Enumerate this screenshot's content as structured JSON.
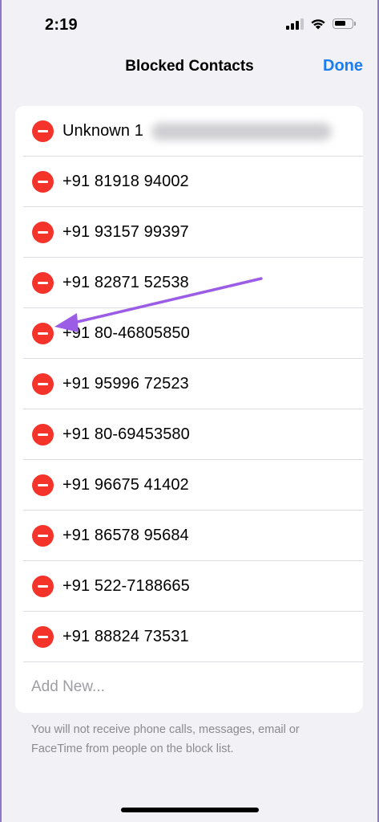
{
  "status_bar": {
    "time": "2:19",
    "icons": [
      "cellular-signal-icon",
      "wifi-icon",
      "battery-icon"
    ]
  },
  "nav": {
    "title": "Blocked Contacts",
    "done_label": "Done"
  },
  "contacts": [
    {
      "label": "Unknown 1",
      "has_blurred_detail": true
    },
    {
      "label": "+91 81918 94002"
    },
    {
      "label": "+91 93157 99397"
    },
    {
      "label": "+91 82871 52538"
    },
    {
      "label": "+91 80-46805850"
    },
    {
      "label": "+91 95996 72523"
    },
    {
      "label": "+91 80-69453580"
    },
    {
      "label": "+91 96675 41402"
    },
    {
      "label": "+91 86578 95684"
    },
    {
      "label": "+91 522-7188665"
    },
    {
      "label": "+91 88824 73531"
    }
  ],
  "add_new_label": "Add New...",
  "footer_note": "You will not receive phone calls, messages, email or FaceTime from people on the block list.",
  "colors": {
    "accent": "#1a7df0",
    "delete": "#f4342b",
    "annotation_arrow": "#9b5de5",
    "background": "#f2f2f6"
  }
}
